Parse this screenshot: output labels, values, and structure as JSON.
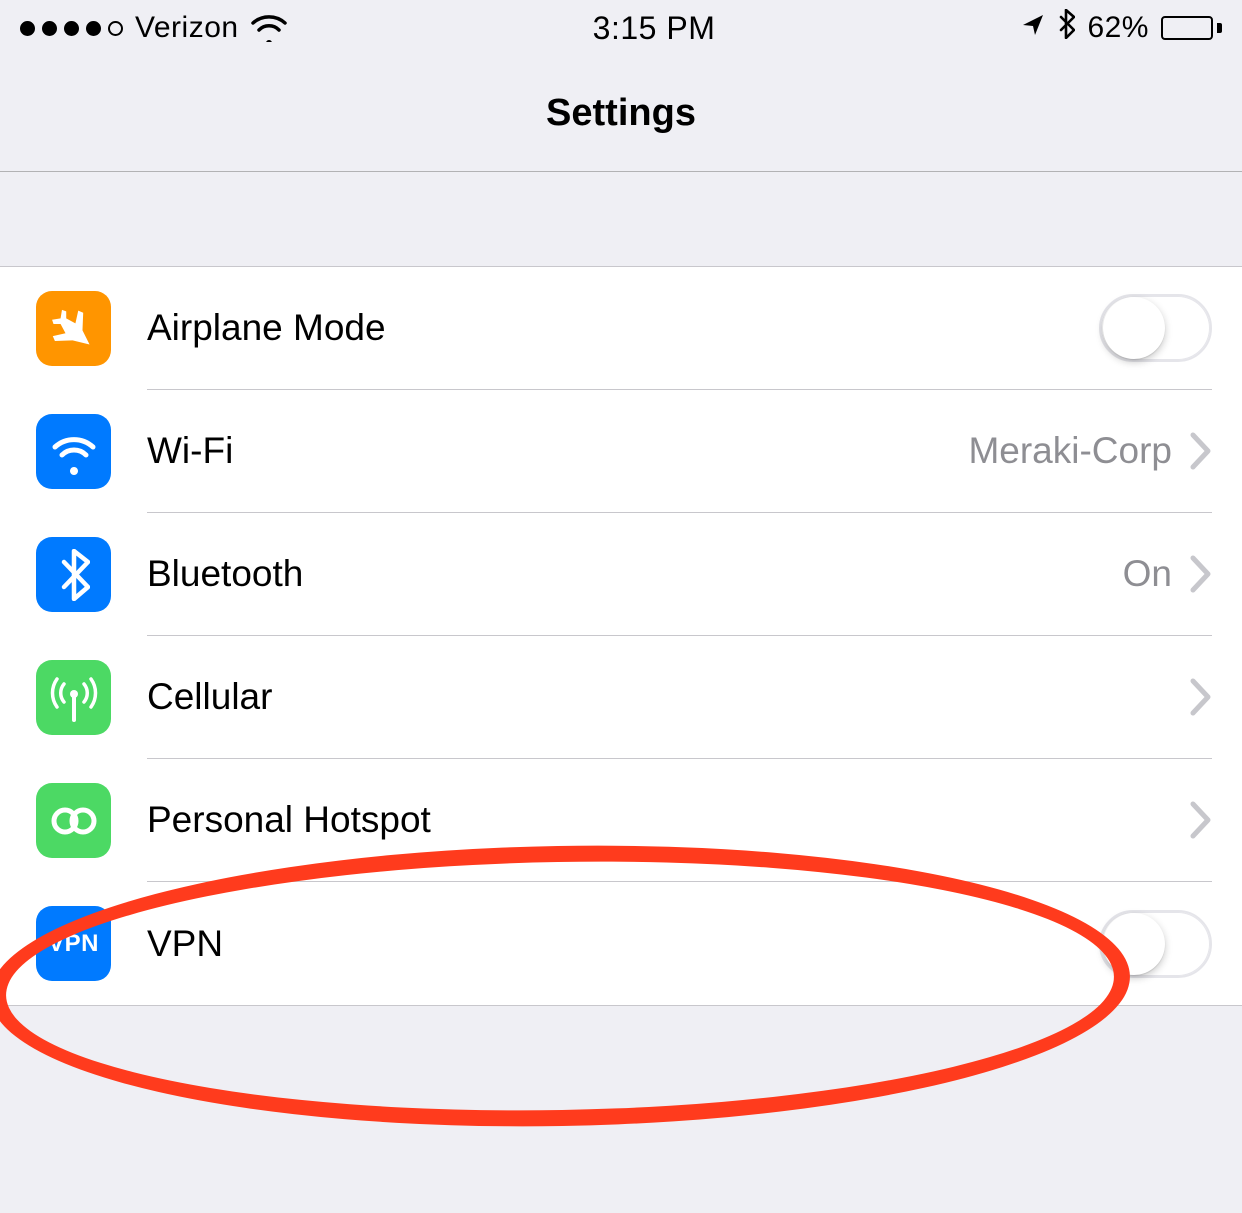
{
  "status": {
    "carrier": "Verizon",
    "time": "3:15 PM",
    "battery_pct": "62%"
  },
  "nav": {
    "title": "Settings"
  },
  "rows": {
    "airplane": {
      "label": "Airplane Mode"
    },
    "wifi": {
      "label": "Wi-Fi",
      "value": "Meraki-Corp"
    },
    "bt": {
      "label": "Bluetooth",
      "value": "On"
    },
    "cell": {
      "label": "Cellular"
    },
    "hotspot": {
      "label": "Personal Hotspot"
    },
    "vpn": {
      "label": "VPN",
      "icon_text": "VPN"
    }
  },
  "colors": {
    "orange": "#ff9500",
    "blue": "#007aff",
    "green": "#4cd964",
    "annotation": "#ff3b1d"
  }
}
